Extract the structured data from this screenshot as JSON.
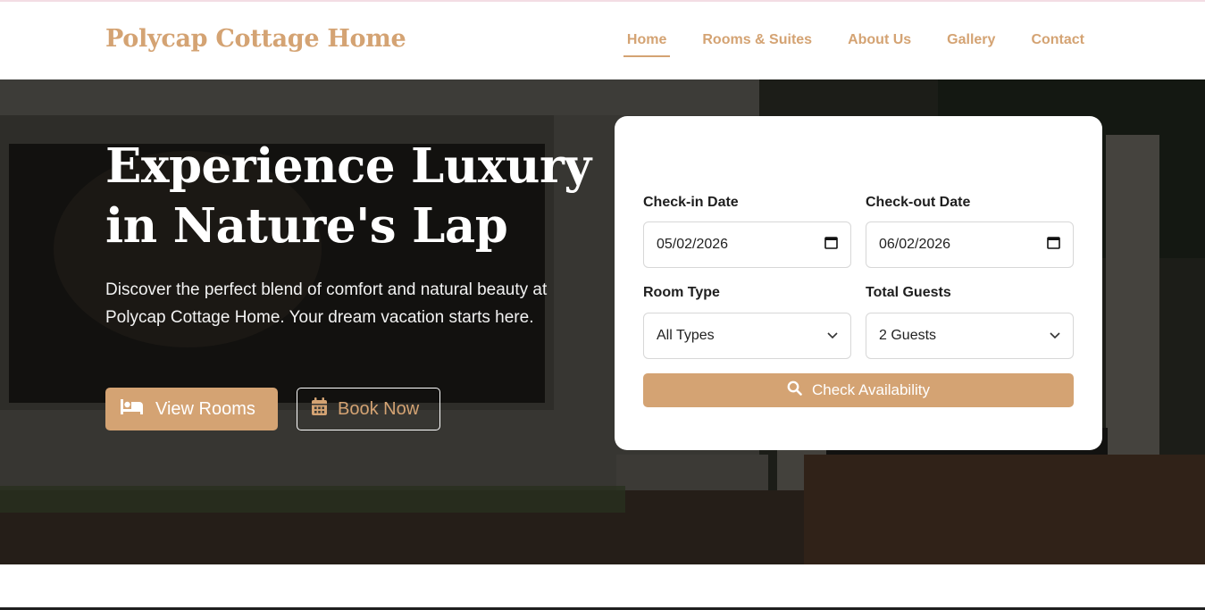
{
  "header": {
    "brand": "Polycap Cottage Home",
    "nav": [
      {
        "label": "Home",
        "active": true
      },
      {
        "label": "Rooms & Suites",
        "active": false
      },
      {
        "label": "About Us",
        "active": false
      },
      {
        "label": "Gallery",
        "active": false
      },
      {
        "label": "Contact",
        "active": false
      }
    ]
  },
  "hero": {
    "title_line1": "Experience Luxury",
    "title_line2": "in Nature's Lap",
    "subtitle": "Discover the perfect blend of comfort and natural beauty at Polycap Cottage Home. Your dream vacation starts here.",
    "view_rooms_label": "View Rooms",
    "book_now_label": "Book Now",
    "icons": {
      "view_rooms": "bed-icon",
      "book_now": "calendar-icon"
    }
  },
  "booking": {
    "checkin_label": "Check-in Date",
    "checkin_value": "05/02/2026",
    "checkout_label": "Check-out Date",
    "checkout_value": "06/02/2026",
    "room_type_label": "Room Type",
    "room_type_value": "All Types",
    "guests_label": "Total Guests",
    "guests_value": "2 Guests",
    "submit_label": "Check Availability",
    "submit_icon": "search-icon"
  },
  "colors": {
    "accent": "#d4a373",
    "text_dark": "#1e1e1e",
    "white": "#ffffff"
  }
}
